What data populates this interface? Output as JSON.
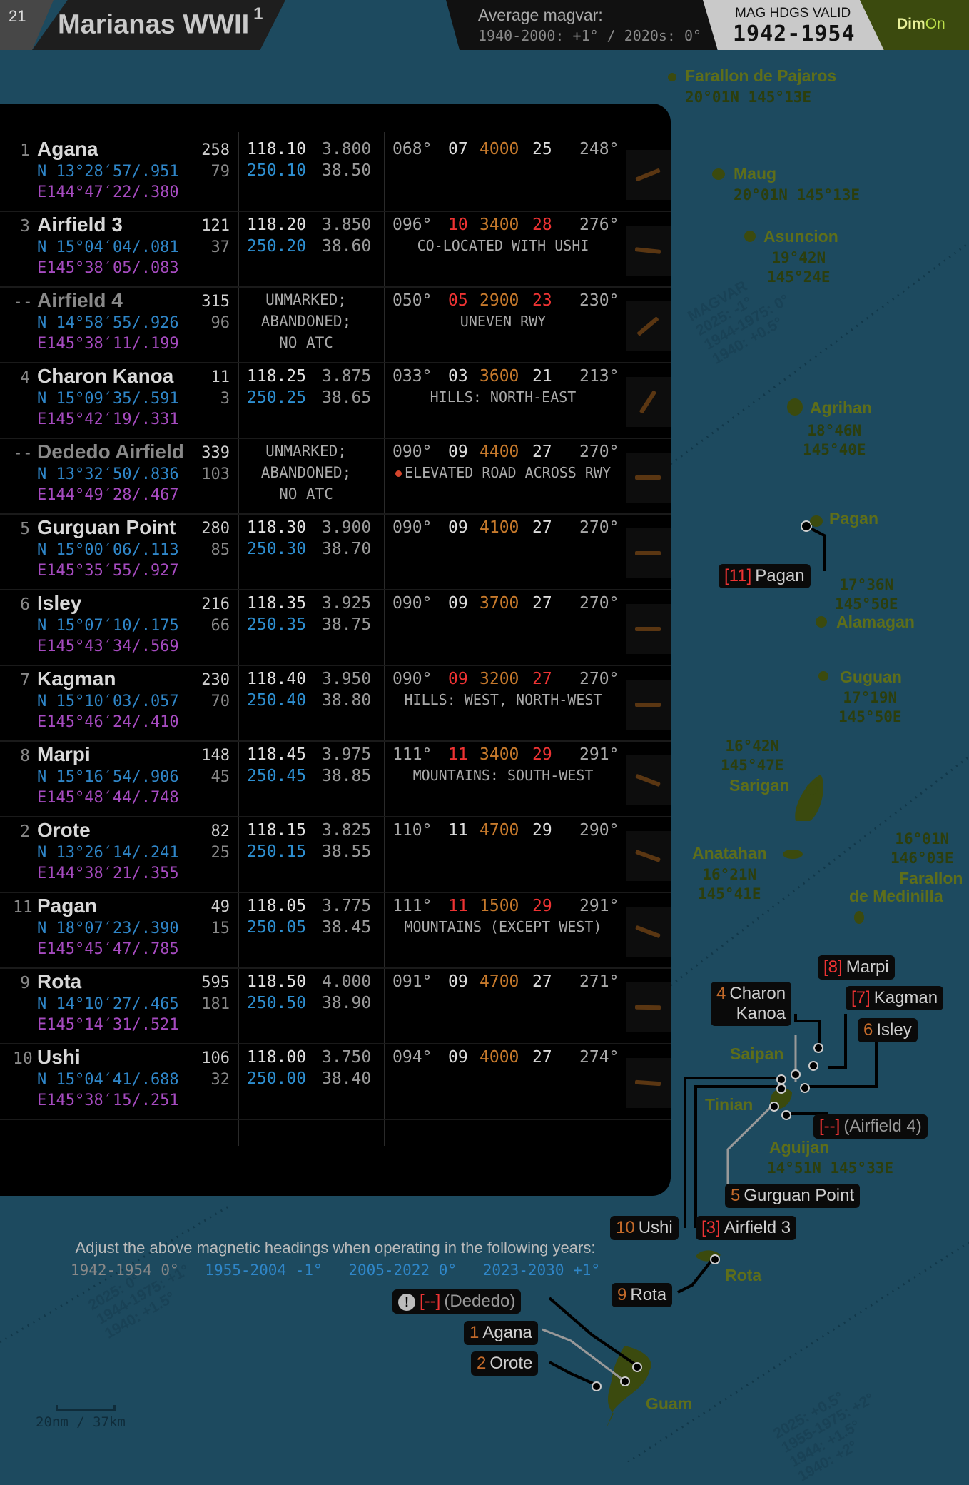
{
  "header": {
    "page_number": "21",
    "title": "Marianas WWII",
    "title_sup": "1",
    "magvar_title": "Average magvar:",
    "magvar_detail": "1940-2000: +1° / 2020s: 0°",
    "valid_label": "MAG HDGS VALID",
    "valid_years": "1942-1954",
    "brand_a": "Dim",
    "brand_b": "On"
  },
  "airfields": [
    {
      "num": "1",
      "name": "Agana",
      "lat": "N 13°28′57/.951",
      "lon": "E144°47′22/.380",
      "elev": "258",
      "elev2": "79",
      "f1": "118.10",
      "f2": "250.10",
      "f3": "3.800",
      "f4": "38.50",
      "h1": "068°",
      "r1": "07",
      "len": "4000",
      "r2": "25",
      "h2": "248°",
      "note": "",
      "red": false
    },
    {
      "num": "3",
      "name": "Airfield 3",
      "lat": "N 15°04′04/.081",
      "lon": "E145°38′05/.083",
      "elev": "121",
      "elev2": "37",
      "f1": "118.20",
      "f2": "250.20",
      "f3": "3.850",
      "f4": "38.60",
      "h1": "096°",
      "r1": "10",
      "len": "3400",
      "r2": "28",
      "h2": "276°",
      "note": "CO-LOCATED WITH USHI",
      "red": true
    },
    {
      "num": "--",
      "name": "Airfield 4",
      "lat": "N 14°58′55/.926",
      "lon": "E145°38′11/.199",
      "elev": "315",
      "elev2": "96",
      "info": [
        "UNMARKED;",
        "ABANDONED;",
        "NO ATC"
      ],
      "h1": "050°",
      "r1": "05",
      "len": "2900",
      "r2": "23",
      "h2": "230°",
      "note": "UNEVEN RWY",
      "red": true,
      "dim": true
    },
    {
      "num": "4",
      "name": "Charon Kanoa",
      "lat": "N 15°09′35/.591",
      "lon": "E145°42′19/.331",
      "elev": "11",
      "elev2": "3",
      "f1": "118.25",
      "f2": "250.25",
      "f3": "3.875",
      "f4": "38.65",
      "h1": "033°",
      "r1": "03",
      "len": "3600",
      "r2": "21",
      "h2": "213°",
      "note": "HILLS: NORTH-EAST",
      "red": false
    },
    {
      "num": "--",
      "name": "Dededo Airfield",
      "lat": "N 13°32′50/.836",
      "lon": "E144°49′28/.467",
      "elev": "339",
      "elev2": "103",
      "info": [
        "UNMARKED;",
        "ABANDONED;",
        "NO ATC"
      ],
      "h1": "090°",
      "r1": "09",
      "len": "4400",
      "r2": "27",
      "h2": "270°",
      "note": "ELEVATED ROAD ACROSS RWY",
      "red": false,
      "dim": true,
      "warn": true
    },
    {
      "num": "5",
      "name": "Gurguan Point",
      "lat": "N 15°00′06/.113",
      "lon": "E145°35′55/.927",
      "elev": "280",
      "elev2": "85",
      "f1": "118.30",
      "f2": "250.30",
      "f3": "3.900",
      "f4": "38.70",
      "h1": "090°",
      "r1": "09",
      "len": "4100",
      "r2": "27",
      "h2": "270°",
      "note": "",
      "red": false
    },
    {
      "num": "6",
      "name": "Isley",
      "lat": "N 15°07′10/.175",
      "lon": "E145°43′34/.569",
      "elev": "216",
      "elev2": "66",
      "f1": "118.35",
      "f2": "250.35",
      "f3": "3.925",
      "f4": "38.75",
      "h1": "090°",
      "r1": "09",
      "len": "3700",
      "r2": "27",
      "h2": "270°",
      "note": "",
      "red": false
    },
    {
      "num": "7",
      "name": "Kagman",
      "lat": "N 15°10′03/.057",
      "lon": "E145°46′24/.410",
      "elev": "230",
      "elev2": "70",
      "f1": "118.40",
      "f2": "250.40",
      "f3": "3.950",
      "f4": "38.80",
      "h1": "090°",
      "r1": "09",
      "len": "3200",
      "r2": "27",
      "h2": "270°",
      "note": "HILLS: WEST, NORTH-WEST",
      "red": true
    },
    {
      "num": "8",
      "name": "Marpi",
      "lat": "N 15°16′54/.906",
      "lon": "E145°48′44/.748",
      "elev": "148",
      "elev2": "45",
      "f1": "118.45",
      "f2": "250.45",
      "f3": "3.975",
      "f4": "38.85",
      "h1": "111°",
      "r1": "11",
      "len": "3400",
      "r2": "29",
      "h2": "291°",
      "note": "MOUNTAINS: SOUTH-WEST",
      "red": true
    },
    {
      "num": "2",
      "name": "Orote",
      "lat": "N 13°26′14/.241",
      "lon": "E144°38′21/.355",
      "elev": "82",
      "elev2": "25",
      "f1": "118.15",
      "f2": "250.15",
      "f3": "3.825",
      "f4": "38.55",
      "h1": "110°",
      "r1": "11",
      "len": "4700",
      "r2": "29",
      "h2": "290°",
      "note": "",
      "red": false
    },
    {
      "num": "11",
      "name": "Pagan",
      "lat": "N 18°07′23/.390",
      "lon": "E145°45′47/.785",
      "elev": "49",
      "elev2": "15",
      "f1": "118.05",
      "f2": "250.05",
      "f3": "3.775",
      "f4": "38.45",
      "h1": "111°",
      "r1": "11",
      "len": "1500",
      "r2": "29",
      "h2": "291°",
      "note": "MOUNTAINS (EXCEPT WEST)",
      "red": true
    },
    {
      "num": "9",
      "name": "Rota",
      "lat": "N 14°10′27/.465",
      "lon": "E145°14′31/.521",
      "elev": "595",
      "elev2": "181",
      "f1": "118.50",
      "f2": "250.50",
      "f3": "4.000",
      "f4": "38.90",
      "h1": "091°",
      "r1": "09",
      "len": "4700",
      "r2": "27",
      "h2": "271°",
      "note": "",
      "red": false
    },
    {
      "num": "10",
      "name": "Ushi",
      "lat": "N 15°04′41/.688",
      "lon": "E145°38′15/.251",
      "elev": "106",
      "elev2": "32",
      "f1": "118.00",
      "f2": "250.00",
      "f3": "3.750",
      "f4": "38.40",
      "h1": "094°",
      "r1": "09",
      "len": "4000",
      "r2": "27",
      "h2": "274°",
      "note": "",
      "red": false
    }
  ],
  "adjust": {
    "text": "Adjust the above magnetic headings when operating in the following years:",
    "y1": "1942-1954 0°",
    "y2": "1955-2004 -1°",
    "y3": "2005-2022 0°",
    "y4": "2023-2030 +1°"
  },
  "map": {
    "places": {
      "farallon_pajaros": "Farallon de Pajaros",
      "farallon_pajaros_c": "20°01N 145°13E",
      "maug": "Maug",
      "maug_c": "20°01N 145°13E",
      "asuncion": "Asuncion",
      "asuncion_c1": "19°42N",
      "asuncion_c2": "145°24E",
      "agrihan": "Agrihan",
      "agrihan_c1": "18°46N",
      "agrihan_c2": "145°40E",
      "pagan": "Pagan",
      "pagan_c1": "17°36N",
      "pagan_c2": "145°50E",
      "alamagan": "Alamagan",
      "guguan": "Guguan",
      "guguan_c1": "17°19N",
      "guguan_c2": "145°50E",
      "sarigan_c1": "16°42N",
      "sarigan_c2": "145°47E",
      "sarigan": "Sarigan",
      "anatahan": "Anatahan",
      "anatahan_c1": "16°21N",
      "anatahan_c2": "145°41E",
      "medinilla_c1": "16°01N",
      "medinilla_c2": "146°03E",
      "medinilla_1": "Farallon",
      "medinilla_2": "de Medinilla",
      "saipan": "Saipan",
      "tinian": "Tinian",
      "aguijan": "Aguijan",
      "aguijan_c": "14°51N 145°33E",
      "rota": "Rota",
      "guam": "Guam"
    },
    "labels": {
      "pagan_n": "[11]",
      "pagan": "Pagan",
      "marpi_n": "[8]",
      "marpi": "Marpi",
      "kagman_n": "[7]",
      "kagman": "Kagman",
      "isley_n": "6",
      "isley": "Isley",
      "charon_n": "4",
      "charon1": "Charon",
      "charon2": "Kanoa",
      "af4_n": "[--]",
      "af4": "(Airfield 4)",
      "gurguan_n": "5",
      "gurguan": "Gurguan Point",
      "ushi_n": "10",
      "ushi": "Ushi",
      "af3_n": "[3]",
      "af3": "Airfield 3",
      "rota_n": "9",
      "rota": "Rota",
      "dededo_n": "[--]",
      "dededo": "(Dededo)",
      "agana_n": "1",
      "agana": "Agana",
      "orote_n": "2",
      "orote": "Orote"
    },
    "magvar": {
      "a1": "MAGVAR",
      "a2": "2025: -1°",
      "a3": "1944-1975: 0°",
      "a4": "1940: +0.5°",
      "b1": "2025: 0°",
      "b2": "1944-1975: +1°",
      "b3": "1940: +1.5°",
      "c1": "2025: +0.5°",
      "c2": "1955-1975: +2°",
      "c3": "1944: +1.5°",
      "c4": "1940: +2°"
    },
    "scale": "20nm / 37km"
  },
  "colors": {
    "background": "#1d4a5f",
    "panel": "#000000",
    "lat": "#2f86c8",
    "lon": "#a64bc0",
    "runway_len": "#c77a2c",
    "red": "#e33333",
    "land": "#3b4a0e"
  }
}
